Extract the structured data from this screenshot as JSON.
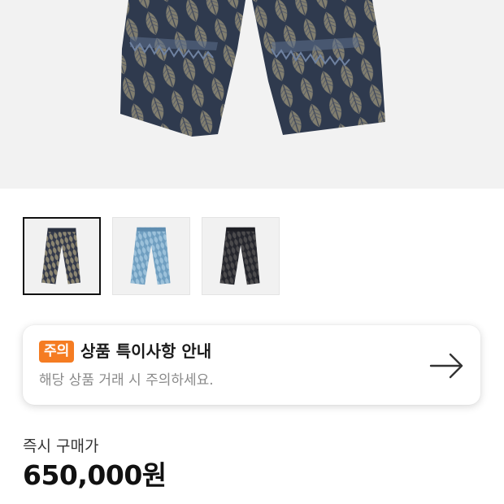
{
  "product": {
    "images": [
      {
        "name": "feather-pattern-denim-pants",
        "colorway": "dark feather print",
        "selected": true
      },
      {
        "name": "light-blue-denim-pants",
        "colorway": "light blue",
        "selected": false
      },
      {
        "name": "black-pattern-denim-pants",
        "colorway": "black",
        "selected": false
      }
    ]
  },
  "notice": {
    "badge": "주의",
    "title": "상품 특이사항 안내",
    "description": "해당 상품 거래 시 주의하세요.",
    "icon": "arrow-right-icon"
  },
  "price": {
    "label": "즉시 구매가",
    "value": "650,000원"
  },
  "colors": {
    "accent": "#f57c22",
    "hero_background": "#f2f2f2"
  }
}
